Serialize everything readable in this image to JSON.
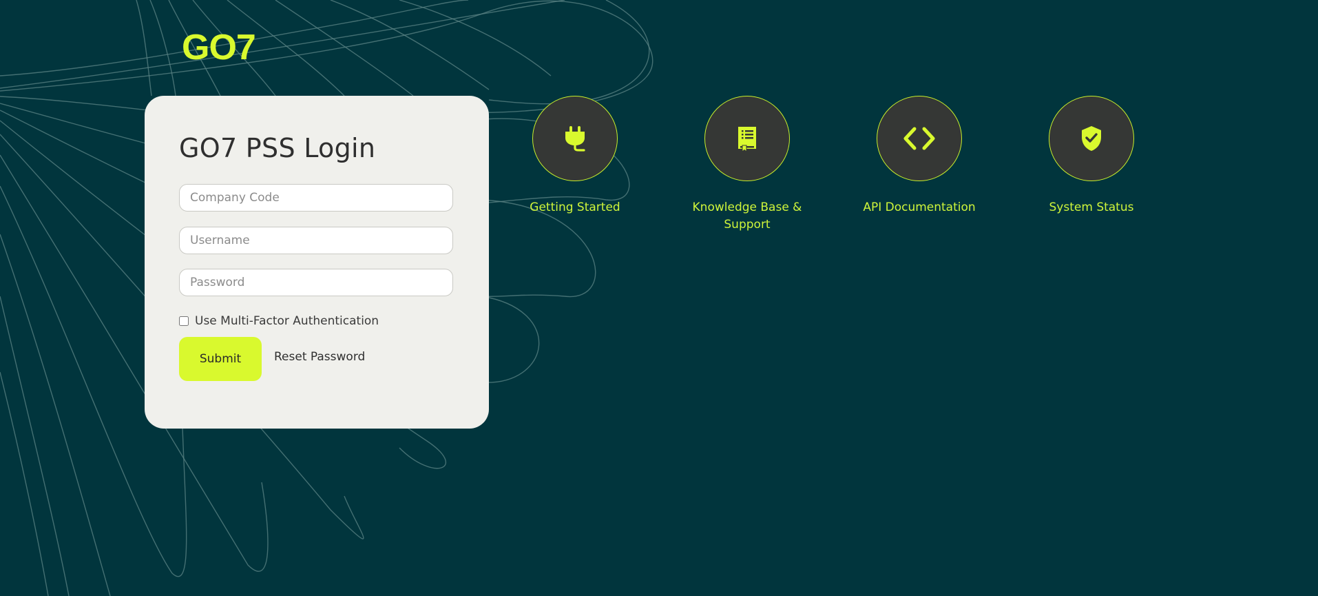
{
  "brand": {
    "logo_text": "GO7",
    "accent_color": "#d9f92e",
    "background_color": "#01353d"
  },
  "login": {
    "title": "GO7 PSS Login",
    "company_code_placeholder": "Company Code",
    "username_placeholder": "Username",
    "password_placeholder": "Password",
    "company_code_value": "",
    "username_value": "",
    "password_value": "",
    "mfa_label": "Use Multi-Factor Authentication",
    "mfa_checked": false,
    "submit_label": "Submit",
    "reset_label": "Reset Password"
  },
  "quick_links": [
    {
      "label": "Getting Started",
      "icon": "plug-icon"
    },
    {
      "label": "Knowledge Base & Support",
      "icon": "book-icon"
    },
    {
      "label": "API Documentation",
      "icon": "code-icon"
    },
    {
      "label": "System Status",
      "icon": "shield-check-icon"
    }
  ]
}
